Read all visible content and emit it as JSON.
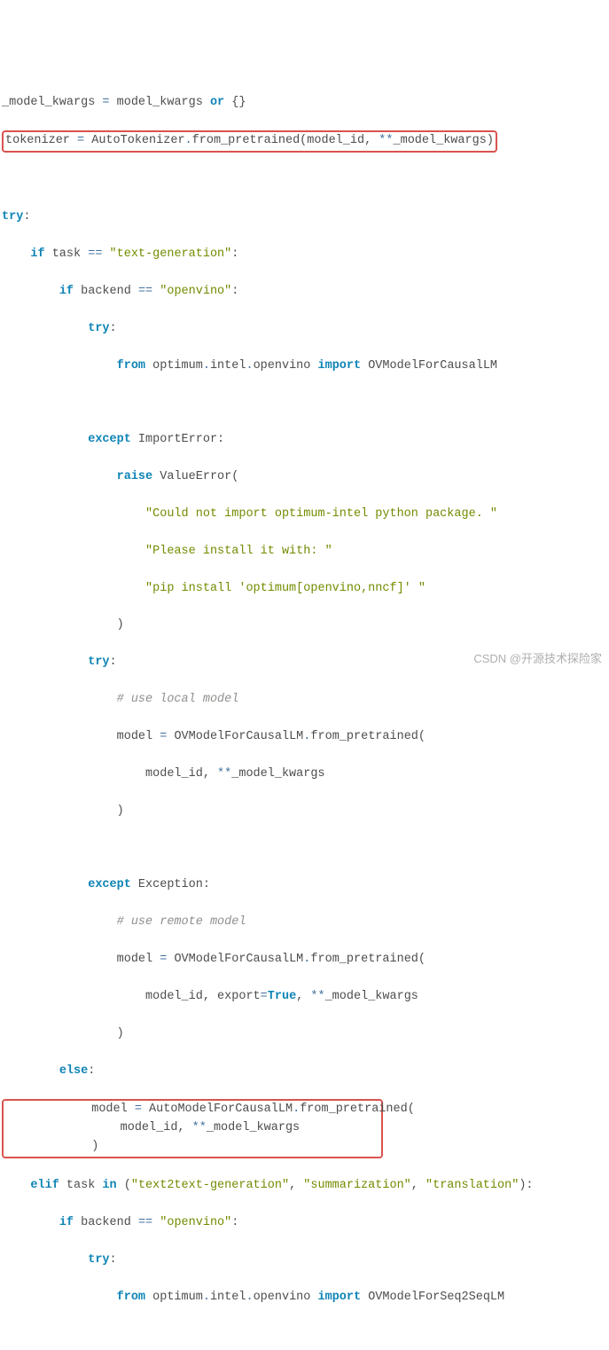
{
  "code": {
    "l1a": "_model_kwargs ",
    "l1b": "=",
    "l1c": " model_kwargs ",
    "l1d": "or",
    "l1e": " {}",
    "l2a": "tokenizer ",
    "l2b": "=",
    "l2c": " AutoTokenizer",
    "l2d": ".",
    "l2e": "from_pretrained(model_id, ",
    "l2f": "**",
    "l2g": "_model_kwargs)",
    "l3a": "try",
    "l3b": ":",
    "l4a": "    ",
    "l4b": "if",
    "l4c": " task ",
    "l4d": "==",
    "l4e": " ",
    "l4f": "\"text-generation\"",
    "l4g": ":",
    "l5a": "        ",
    "l5b": "if",
    "l5c": " backend ",
    "l5d": "==",
    "l5e": " ",
    "l5f": "\"openvino\"",
    "l5g": ":",
    "l6a": "            ",
    "l6b": "try",
    "l6c": ":",
    "l7a": "                ",
    "l7b": "from",
    "l7c": " optimum",
    "l7d": ".",
    "l7e": "intel",
    "l7f": ".",
    "l7g": "openvino ",
    "l7h": "import",
    "l7i": " OVModelForCausalLM",
    "l8a": "            ",
    "l8b": "except",
    "l8c": " ImportError:",
    "l9a": "                ",
    "l9b": "raise",
    "l9c": " ValueError(",
    "l10a": "                    ",
    "l10b": "\"Could not import optimum-intel python package. \"",
    "l11a": "                    ",
    "l11b": "\"Please install it with: \"",
    "l12a": "                    ",
    "l12b": "\"pip install 'optimum[openvino,nncf]' \"",
    "l13a": "                )",
    "l14a": "            ",
    "l14b": "try",
    "l14c": ":",
    "l15a": "                ",
    "l15b": "# use local model",
    "l16a": "                model ",
    "l16b": "=",
    "l16c": " OVModelForCausalLM",
    "l16d": ".",
    "l16e": "from_pretrained(",
    "l17a": "                    model_id, ",
    "l17b": "**",
    "l17c": "_model_kwargs",
    "l18a": "                )",
    "l19a": "            ",
    "l19b": "except",
    "l19c": " Exception:",
    "l20a": "                ",
    "l20b": "# use remote model",
    "l21a": "                model ",
    "l21b": "=",
    "l21c": " OVModelForCausalLM",
    "l21d": ".",
    "l21e": "from_pretrained(",
    "l22a": "                    model_id, export",
    "l22b": "=",
    "l22c": "True",
    "l22d": ", ",
    "l22e": "**",
    "l22f": "_model_kwargs",
    "l23a": "                )",
    "l24a": "        ",
    "l24b": "else",
    "l24c": ":",
    "l25a": "            model ",
    "l25b": "=",
    "l25c": " AutoModelForCausalLM",
    "l25d": ".",
    "l25e": "from_pretrained(",
    "l26a": "                model_id, ",
    "l26b": "**",
    "l26c": "_model_kwargs",
    "l27a": "            )",
    "l28a": "    ",
    "l28b": "elif",
    "l28c": " task ",
    "l28d": "in",
    "l28e": " (",
    "l28f": "\"text2text-generation\"",
    "l28g": ", ",
    "l28h": "\"summarization\"",
    "l28i": ", ",
    "l28j": "\"translation\"",
    "l28k": "):",
    "l29a": "        ",
    "l29b": "if",
    "l29c": " backend ",
    "l29d": "==",
    "l29e": " ",
    "l29f": "\"openvino\"",
    "l29g": ":",
    "l30a": "            ",
    "l30b": "try",
    "l30c": ":",
    "l31a": "                ",
    "l31b": "from",
    "l31c": " optimum",
    "l31d": ".",
    "l31e": "intel",
    "l31f": ".",
    "l31g": "openvino ",
    "l31h": "import",
    "l31i": " OVModelForSeq2SeqLM"
  },
  "watermark": "CSDN @开源技术探险家"
}
